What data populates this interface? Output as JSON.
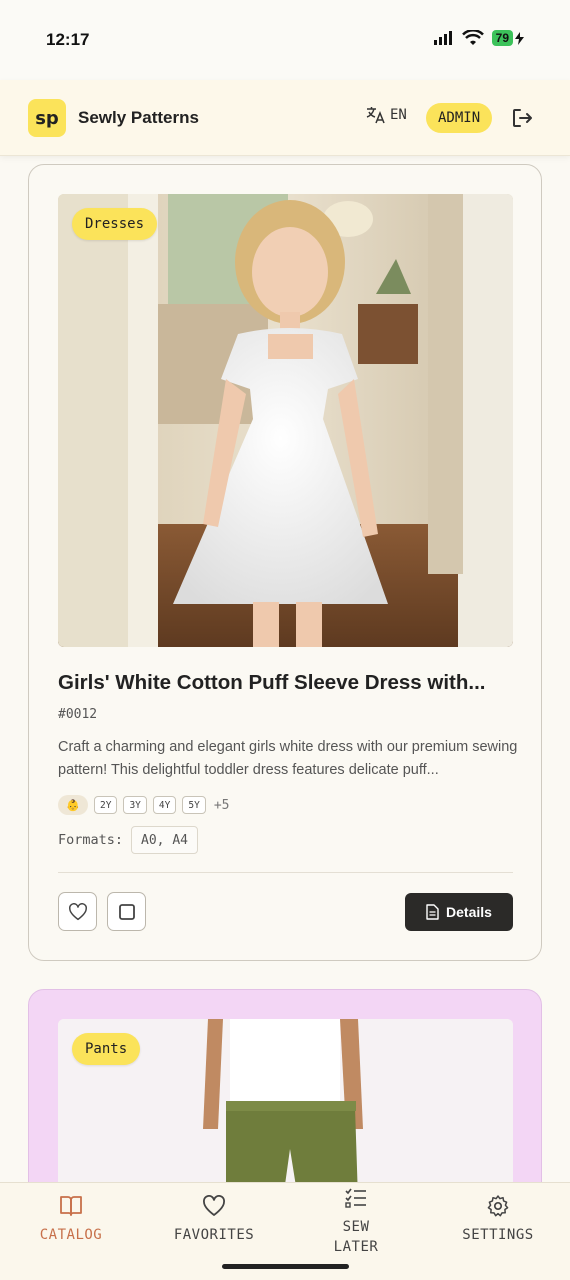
{
  "status_bar": {
    "time": "12:17",
    "battery": "79"
  },
  "header": {
    "logo_text": "sp",
    "app_title": "Sewly Patterns",
    "language": "EN",
    "admin_label": "ADMIN"
  },
  "products": [
    {
      "category": "Dresses",
      "title": "Girls' White Cotton Puff Sleeve Dress with...",
      "sku": "#0012",
      "description": "Craft a charming and elegant girls white dress with our premium sewing pattern! This delightful toddler dress features delicate puff...",
      "age_icon": "baby-icon",
      "sizes": [
        "2Y",
        "3Y",
        "4Y",
        "5Y"
      ],
      "sizes_more": "+5",
      "formats_label": "Formats:",
      "formats_value": "A0, A4",
      "details_label": "Details"
    },
    {
      "category": "Pants"
    }
  ],
  "nav": {
    "catalog": "CATALOG",
    "favorites": "FAVORITES",
    "sew_later_1": "SEW",
    "sew_later_2": "LATER",
    "settings": "SETTINGS"
  },
  "colors": {
    "accent_yellow": "#fbe35a",
    "active_nav": "#c7704a",
    "dark_button": "#2b2a28",
    "card2_bg": "#f3d6f5"
  }
}
